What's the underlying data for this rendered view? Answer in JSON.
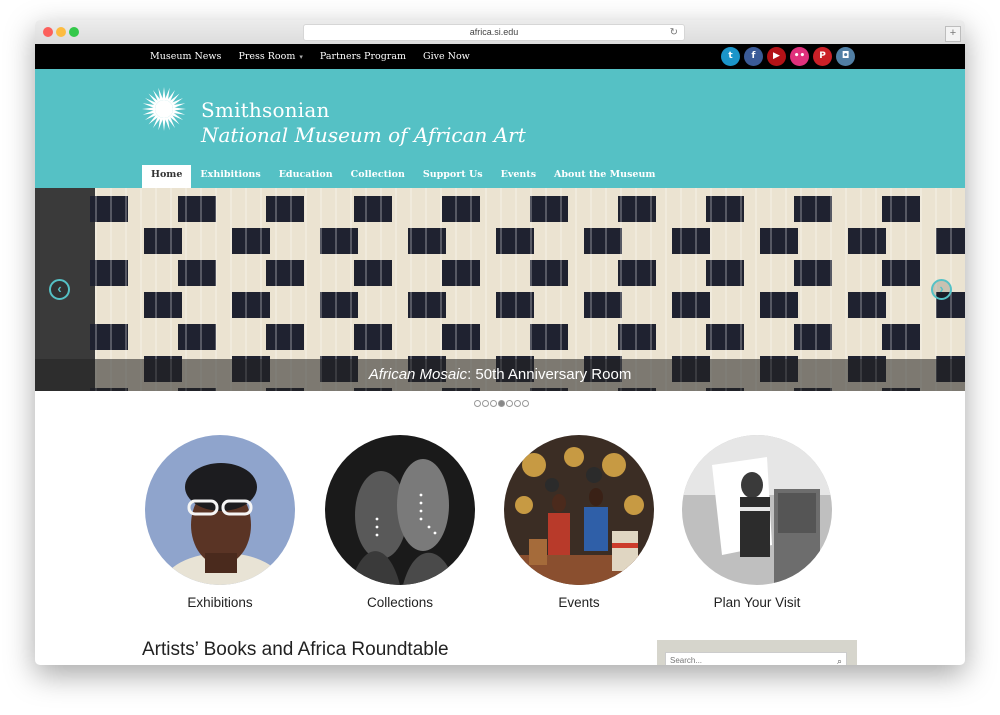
{
  "browser": {
    "url": "africa.si.edu",
    "newtab": "+"
  },
  "topnav": {
    "items": [
      "Museum News",
      "Press Room",
      "Partners Program",
      "Give Now"
    ],
    "dropdown_caret": "▾",
    "social": [
      {
        "icon": "twitter-icon",
        "glyph": "t",
        "color": "#1b95c9"
      },
      {
        "icon": "facebook-icon",
        "glyph": "f",
        "color": "#3b5b97"
      },
      {
        "icon": "youtube-icon",
        "glyph": "▶",
        "color": "#b31217"
      },
      {
        "icon": "flickr-icon",
        "glyph": "••",
        "color": "#e0307c"
      },
      {
        "icon": "pinterest-icon",
        "glyph": "P",
        "color": "#cb2027"
      },
      {
        "icon": "instagram-icon",
        "glyph": "◘",
        "color": "#517fa4"
      }
    ]
  },
  "header": {
    "brand_line1": "Smithsonian",
    "brand_line2": "National Museum of African Art",
    "accent": "#55c1c5"
  },
  "mainnav": {
    "items": [
      "Home",
      "Exhibitions",
      "Education",
      "Collection",
      "Support Us",
      "Events",
      "About the Museum"
    ],
    "active_index": 0
  },
  "hero": {
    "caption_italic": "African Mosaic",
    "caption_rest": ": 50th Anniversary Room",
    "prev_glyph": "‹",
    "next_glyph": "›",
    "slide_count": 7,
    "active_slide": 3
  },
  "tiles": [
    {
      "label": "Exhibitions"
    },
    {
      "label": "Collections"
    },
    {
      "label": "Events"
    },
    {
      "label": "Plan Your Visit"
    }
  ],
  "article": {
    "title": "Artists’ Books and Africa Roundtable"
  },
  "sidebar": {
    "search_placeholder": "Search...",
    "search_glyph": "⌕"
  }
}
